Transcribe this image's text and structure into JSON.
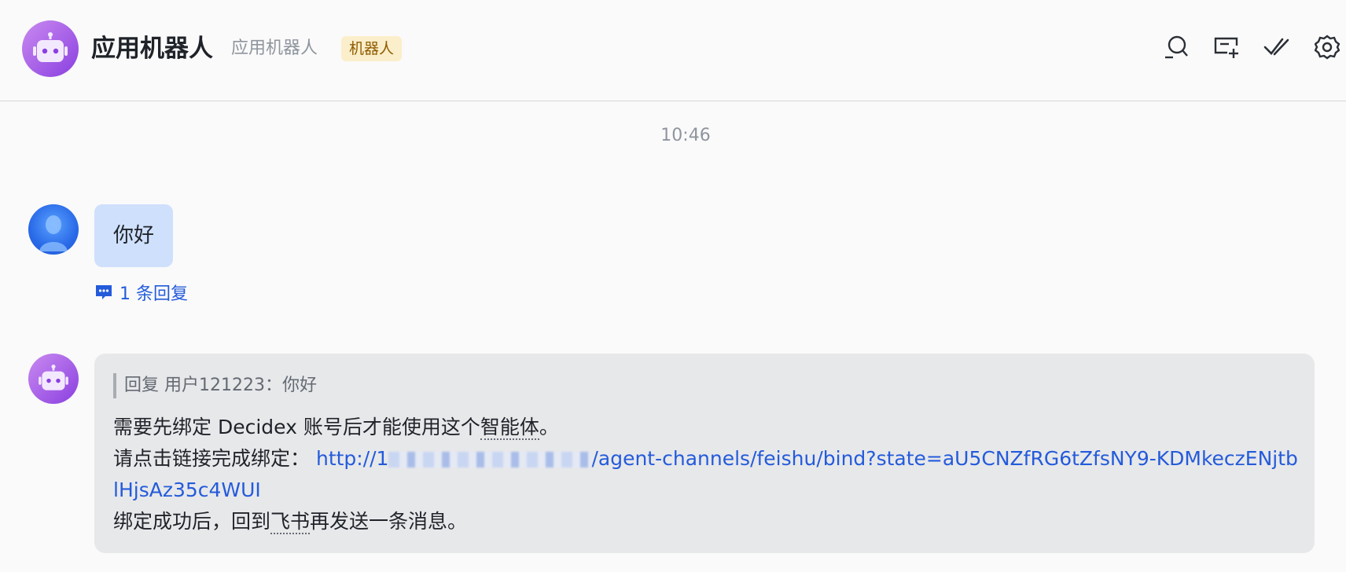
{
  "header": {
    "title": "应用机器人",
    "subtitle": "应用机器人",
    "badge": "机器人",
    "icons": [
      "search-icon",
      "new-chat-icon",
      "mark-done-icon",
      "settings-icon"
    ]
  },
  "timestamp": "10:46",
  "messages": [
    {
      "sender": "user",
      "text": "你好",
      "reply_count_label": "1 条回复"
    },
    {
      "sender": "bot",
      "quote": "回复 用户121223：你好",
      "line1_prefix": "需要先绑定 Decidex 账号后才能使用这个",
      "line1_term": "智能体",
      "line1_suffix": "。",
      "line2_prefix": "请点击链接完成绑定：",
      "link_start": "http://1",
      "link_rest": "/agent-channels/feishu/bind?state=aU5CNZfRG6tZfsNY9-KDMkeczENjtblHjsAz35c4WUI",
      "line3_prefix": "绑定成功后，回到",
      "line3_term": "飞书",
      "line3_suffix": "再发送一条消息。"
    }
  ],
  "colors": {
    "link": "#245bdb",
    "user_bubble": "#cfe0fc",
    "bot_bubble": "#e7e8ea",
    "badge_bg": "#fbeeca",
    "badge_text": "#8f5b00"
  }
}
